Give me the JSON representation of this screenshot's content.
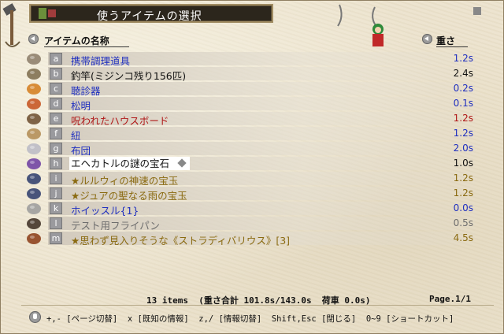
{
  "window": {
    "title": "使うアイテムの選択"
  },
  "header": {
    "name_label": "アイテムの名称",
    "weight_label": "重さ"
  },
  "colors": {
    "blue": "#2030c0",
    "black": "#111111",
    "red": "#b01818",
    "gold": "#8a6a10",
    "gray": "#6e6e6e"
  },
  "items": [
    {
      "key": "a",
      "name": "携帯調理道具",
      "weight": "1.2s",
      "color": "blue",
      "icon": "cooking-kit-icon"
    },
    {
      "key": "b",
      "name": "釣竿(ミジンコ残り156匹)",
      "weight": "2.4s",
      "color": "black",
      "icon": "fishing-rod-icon"
    },
    {
      "key": "c",
      "name": "聴診器",
      "weight": "0.2s",
      "color": "blue",
      "icon": "stethoscope-icon"
    },
    {
      "key": "d",
      "name": "松明",
      "weight": "0.1s",
      "color": "blue",
      "icon": "torch-icon"
    },
    {
      "key": "e",
      "name": "呪われたハウスボード",
      "weight": "1.2s",
      "color": "red",
      "icon": "house-board-icon"
    },
    {
      "key": "f",
      "name": "紐",
      "weight": "1.2s",
      "color": "blue",
      "icon": "rope-icon"
    },
    {
      "key": "g",
      "name": "布団",
      "weight": "2.0s",
      "color": "blue",
      "icon": "futon-icon"
    },
    {
      "key": "h",
      "name": "エヘカトルの謎の宝石",
      "weight": "1.0s",
      "color": "black",
      "icon": "jewel-icon"
    },
    {
      "key": "i",
      "name": "★ルルウィの神速の宝玉",
      "weight": "1.2s",
      "color": "gold",
      "icon": "orb-icon"
    },
    {
      "key": "j",
      "name": "★ジュアの聖なる雨の宝玉",
      "weight": "1.2s",
      "color": "gold",
      "icon": "orb-icon"
    },
    {
      "key": "k",
      "name": "ホイッスル{1}",
      "weight": "0.0s",
      "color": "blue",
      "icon": "whistle-icon"
    },
    {
      "key": "l",
      "name": "テスト用フライパン",
      "weight": "0.5s",
      "color": "gray",
      "icon": "frying-pan-icon"
    },
    {
      "key": "m",
      "name": "★思わず見入りそうな《ストラディバリウス》[3]",
      "weight": "4.5s",
      "color": "gold",
      "icon": "violin-icon"
    }
  ],
  "selected_index": 7,
  "footer": {
    "stats": "13 items  (重さ合計 101.8s/143.0s  荷車 0.0s)",
    "page": "Page.1/1",
    "help": "+,- [ページ切替]  x [既知の情報]  z,/ [情報切替]  Shift,Esc [閉じる]  0~9 [ショートカット]"
  }
}
